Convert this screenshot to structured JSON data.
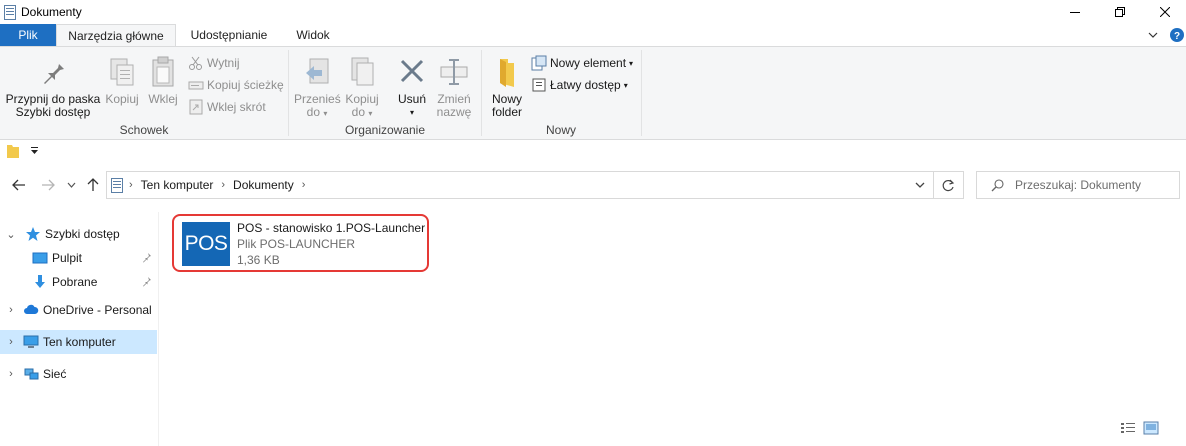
{
  "window": {
    "title": "Dokumenty"
  },
  "ribbon_tabs": {
    "file": "Plik",
    "home": "Narzędzia główne",
    "share": "Udostępnianie",
    "view": "Widok"
  },
  "clipboard": {
    "pin_line1": "Przypnij do paska",
    "pin_line2": "Szybki dostęp",
    "copy": "Kopiuj",
    "paste": "Wklej",
    "cut": "Wytnij",
    "copy_path": "Kopiuj ścieżkę",
    "paste_shortcut": "Wklej skrót",
    "group_label": "Schowek"
  },
  "organize": {
    "move_line1": "Przenieś",
    "move_line2": "do",
    "copy_line1": "Kopiuj",
    "copy_line2": "do",
    "delete": "Usuń",
    "rename_line1": "Zmień",
    "rename_line2": "nazwę",
    "group_label": "Organizowanie"
  },
  "new_group": {
    "new_folder_line1": "Nowy",
    "new_folder_line2": "folder",
    "new_item": "Nowy element",
    "easy_access": "Łatwy dostęp",
    "group_label": "Nowy"
  },
  "address": {
    "crumbs": [
      "Ten komputer",
      "Dokumenty"
    ],
    "search_placeholder": "Przeszukaj: Dokumenty"
  },
  "nav_pane": {
    "quick_access": "Szybki dostęp",
    "desktop": "Pulpit",
    "downloads": "Pobrane",
    "onedrive": "OneDrive - Personal",
    "this_pc": "Ten komputer",
    "network": "Sieć"
  },
  "file": {
    "thumb_text": "POS",
    "name": "POS - stanowisko 1.POS-Launcher",
    "type": "Plik POS-LAUNCHER",
    "size": "1,36 KB"
  },
  "colors": {
    "accent": "#1e6fc2",
    "selection": "#cce8ff",
    "highlight_border": "#e53935",
    "thumb": "#1467b5"
  }
}
